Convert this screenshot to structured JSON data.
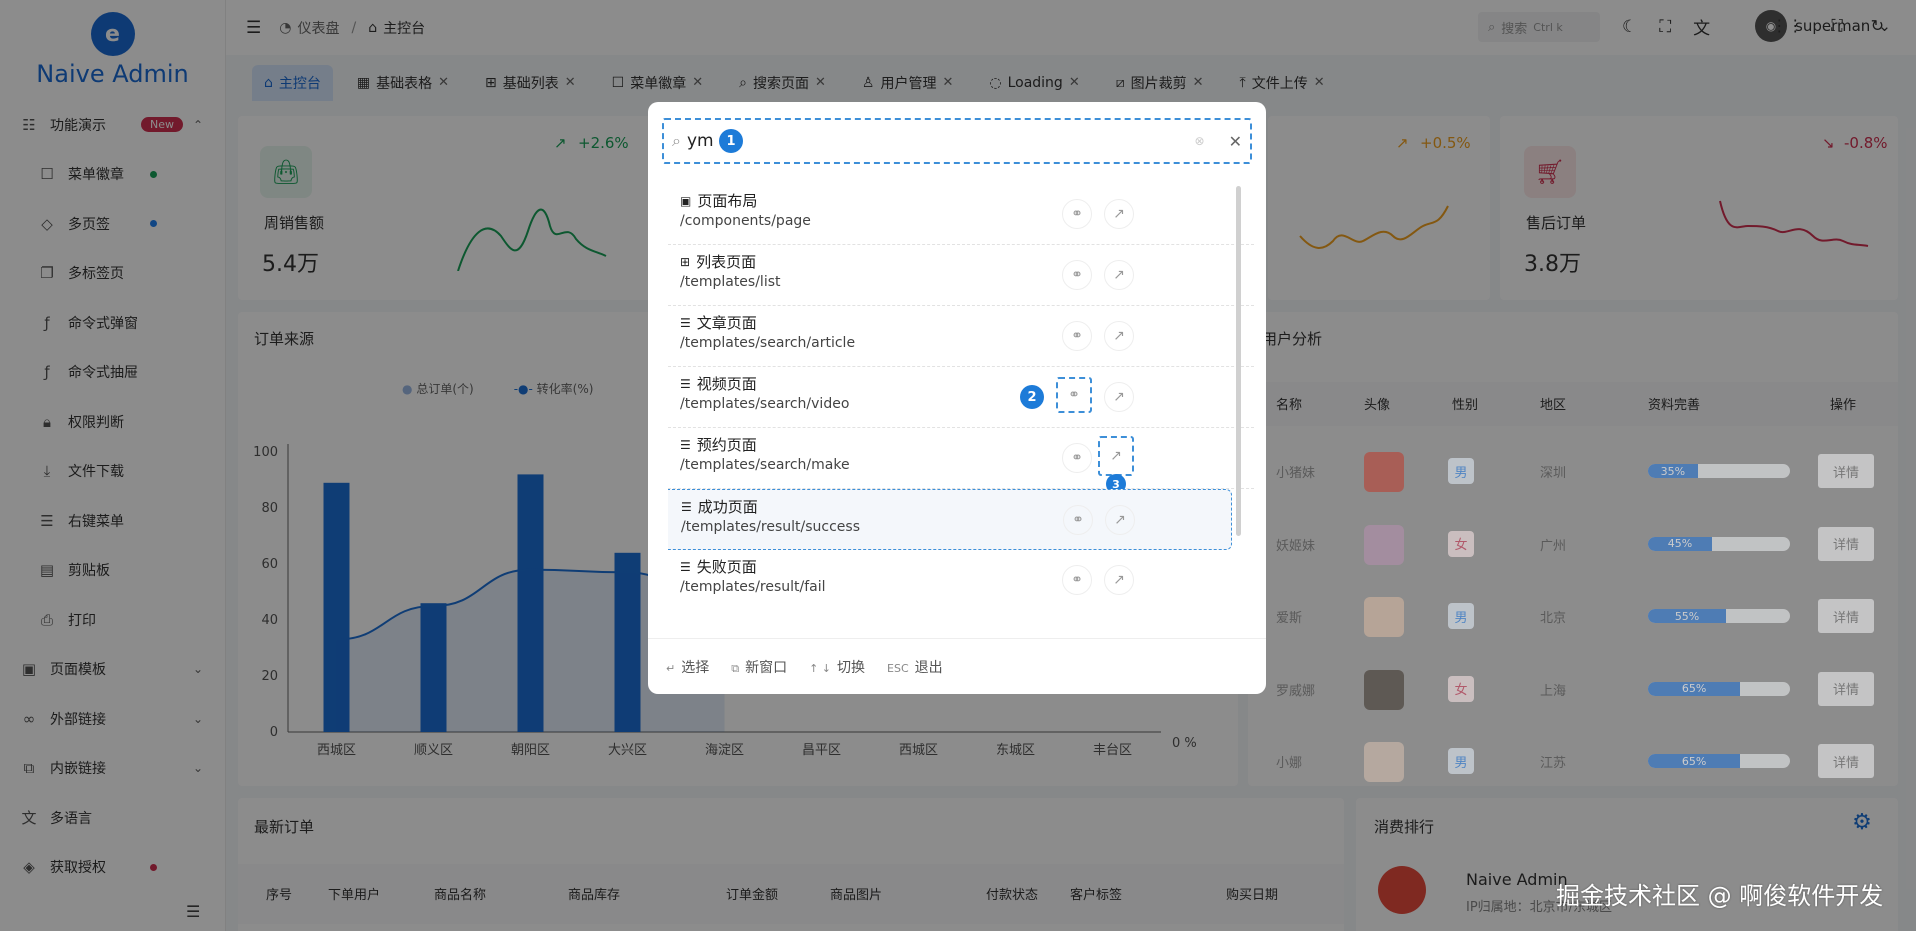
{
  "app": {
    "name": "Naive Admin"
  },
  "sidebar": {
    "badge_new": "New",
    "items": [
      {
        "label": "功能演示",
        "icon": "sliders-icon"
      },
      {
        "label": "菜单徽章",
        "icon": "square-icon"
      },
      {
        "label": "多页签",
        "icon": "tag-icon"
      },
      {
        "label": "多标签页",
        "icon": "copy-icon"
      },
      {
        "label": "命令式弹窗",
        "icon": "function-icon"
      },
      {
        "label": "命令式抽屉",
        "icon": "function-icon"
      },
      {
        "label": "权限判断",
        "icon": "lock-icon"
      },
      {
        "label": "文件下载",
        "icon": "download-icon"
      },
      {
        "label": "右键菜单",
        "icon": "menu-icon"
      },
      {
        "label": "剪贴板",
        "icon": "clipboard-icon"
      },
      {
        "label": "打印",
        "icon": "printer-icon"
      },
      {
        "label": "页面模板",
        "icon": "layout-icon"
      },
      {
        "label": "外部链接",
        "icon": "link-icon"
      },
      {
        "label": "内嵌链接",
        "icon": "embed-icon"
      },
      {
        "label": "多语言",
        "icon": "translate-icon"
      },
      {
        "label": "获取授权",
        "icon": "diamond-icon"
      }
    ],
    "dot_colors": {
      "green": "#18a058",
      "blue": "#2080f0",
      "red": "#d03050"
    }
  },
  "header": {
    "breadcrumb": [
      "仪表盘",
      "/",
      "主控台"
    ],
    "search_placeholder": "搜索",
    "search_shortcut": "Ctrl k",
    "username": "superman"
  },
  "tabs": [
    "主控台",
    "基础表格",
    "基础列表",
    "菜单徽章",
    "搜索页面",
    "用户管理",
    "Loading",
    "图片裁剪",
    "文件上传"
  ],
  "stats": [
    {
      "title": "周销售额",
      "value": "5.4万",
      "change": "+2.6%"
    },
    {
      "change": "+0.5%"
    },
    {
      "title": "售后订单",
      "value": "3.8万",
      "change": "-0.8%"
    }
  ],
  "order_source": {
    "title": "订单来源",
    "legend": [
      "总订单(个)",
      "转化率(%)"
    ],
    "right_axis_tick": "0 %"
  },
  "chart_data": {
    "type": "bar",
    "categories": [
      "西城区",
      "顺义区",
      "朝阳区",
      "大兴区",
      "海淀区",
      "昌平区",
      "西城区",
      "东城区",
      "丰台区"
    ],
    "series": [
      {
        "name": "总订单(个)",
        "values": [
          89,
          46,
          92,
          64,
          null,
          null,
          null,
          null,
          null
        ]
      },
      {
        "name": "转化率(%)",
        "values": [
          33,
          45,
          58,
          57,
          45,
          null,
          null,
          null,
          null
        ]
      }
    ],
    "ylim": [
      0,
      100
    ],
    "yticks": [
      0,
      20,
      40,
      60,
      80,
      100
    ]
  },
  "user_analysis": {
    "title": "用户分析",
    "headers": [
      "名称",
      "头像",
      "性别",
      "地区",
      "资料完善",
      "操作"
    ],
    "detail_label": "详情",
    "rows": [
      {
        "name": "小猪妹",
        "gender": "男",
        "region": "深圳",
        "progress": 35,
        "progress_label": "35%"
      },
      {
        "name": "妖姬妹",
        "gender": "女",
        "region": "广州",
        "progress": 45,
        "progress_label": "45%"
      },
      {
        "name": "爱斯",
        "gender": "男",
        "region": "北京",
        "progress": 55,
        "progress_label": "55%"
      },
      {
        "name": "罗威娜",
        "gender": "女",
        "region": "上海",
        "progress": 65,
        "progress_label": "65%"
      },
      {
        "name": "小娜",
        "gender": "男",
        "region": "江苏",
        "progress": 65,
        "progress_label": "65%"
      }
    ]
  },
  "latest_orders": {
    "title": "最新订单",
    "headers": [
      "序号",
      "下单用户",
      "商品名称",
      "商品库存",
      "订单金额",
      "商品图片",
      "付款状态",
      "客户标签",
      "购买日期"
    ]
  },
  "spend_rank": {
    "title": "消费排行",
    "name": "Naive Admin",
    "location": "IP归属地：北京市/东城区"
  },
  "modal": {
    "query": "ym",
    "badges": [
      "1",
      "2",
      "3"
    ],
    "results": [
      {
        "icon": "page-icon",
        "title": "页面布局",
        "path": "/components/page"
      },
      {
        "icon": "grid-icon",
        "title": "列表页面",
        "path": "/templates/list"
      },
      {
        "icon": "lines-icon",
        "title": "文章页面",
        "path": "/templates/search/article"
      },
      {
        "icon": "lines-icon",
        "title": "视频页面",
        "path": "/templates/search/video"
      },
      {
        "icon": "lines-icon",
        "title": "预约页面",
        "path": "/templates/search/make"
      },
      {
        "icon": "lines-icon",
        "title": "成功页面",
        "path": "/templates/result/success"
      },
      {
        "icon": "lines-icon",
        "title": "失败页面",
        "path": "/templates/result/fail"
      }
    ],
    "footer": [
      {
        "key": "↵",
        "label": "选择"
      },
      {
        "key": "⧉",
        "label": "新窗口"
      },
      {
        "key": "↑ ↓",
        "label": "切换"
      },
      {
        "key": "ESC",
        "label": "退出"
      }
    ]
  },
  "watermark": "掘金技术社区 @ 啊俊软件开发"
}
